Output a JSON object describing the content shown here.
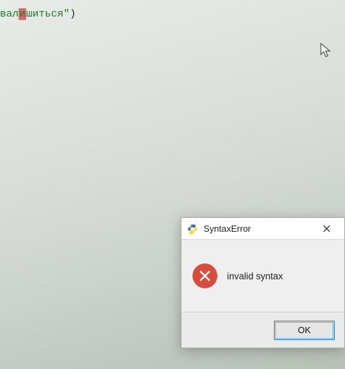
{
  "editor": {
    "fragment_before": "вал",
    "caret_char": "и",
    "fragment_after": "шиться\"",
    "trailing": ")"
  },
  "dialog": {
    "title": "SyntaxError",
    "message": "invalid syntax",
    "ok_label": "OK"
  },
  "icons": {
    "app": "python-icon",
    "error": "error-cross-icon",
    "close": "close-icon",
    "cursor": "cursor-arrow-icon"
  }
}
